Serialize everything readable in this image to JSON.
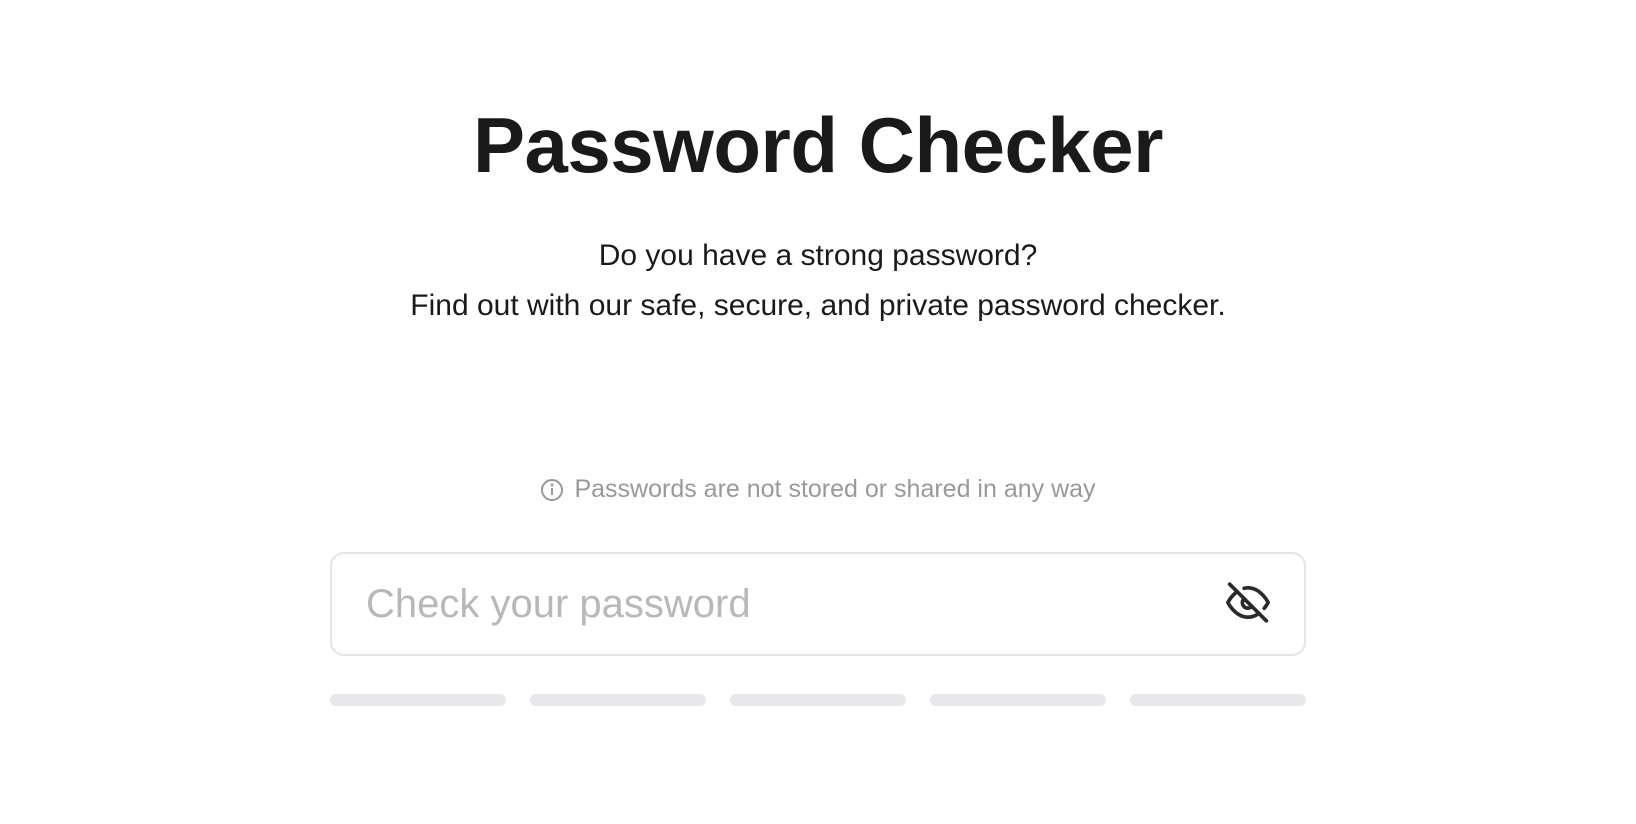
{
  "header": {
    "title": "Password Checker",
    "subtitle_line1": "Do you have a strong password?",
    "subtitle_line2": "Find out with our safe, secure, and private password checker."
  },
  "info": {
    "text": "Passwords are not stored or shared in any way"
  },
  "input": {
    "placeholder": "Check your password",
    "value": ""
  },
  "strength": {
    "segments": 5
  }
}
